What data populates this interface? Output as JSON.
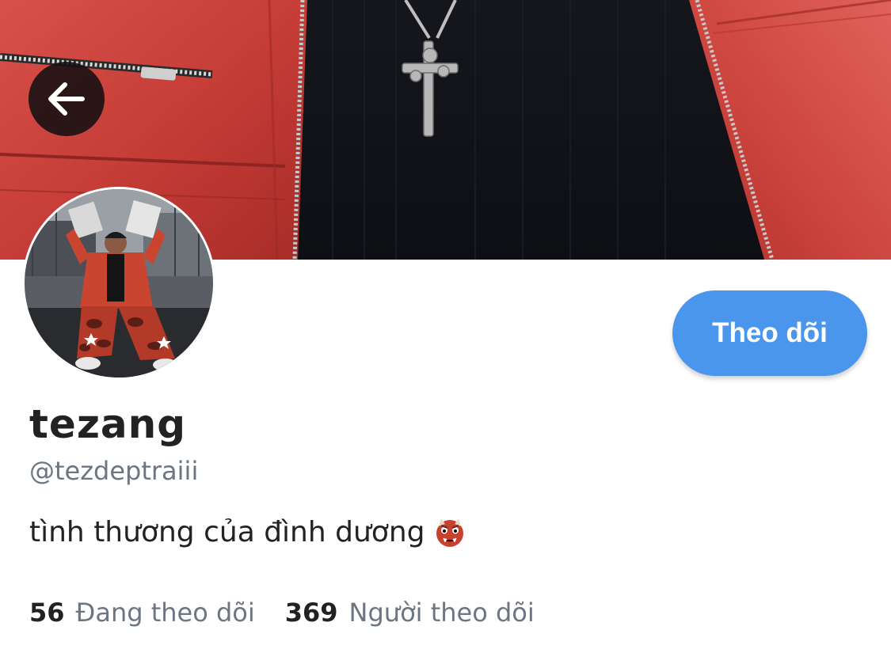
{
  "profile": {
    "display_name": "tezang",
    "handle": "@tezdeptraiii",
    "bio": "tình thương của đình dương",
    "bio_emoji": "ogre-emoji"
  },
  "actions": {
    "back_icon": "arrow-left-icon",
    "follow_label": "Theo dõi"
  },
  "stats": {
    "following_count": "56",
    "following_label": "Đang theo dõi",
    "followers_count": "369",
    "followers_label": "Người theo dõi"
  },
  "colors": {
    "accent": "#4a96ec",
    "text_primary": "#222222",
    "text_secondary": "#6b7682",
    "banner_jacket": "#c8403a"
  }
}
